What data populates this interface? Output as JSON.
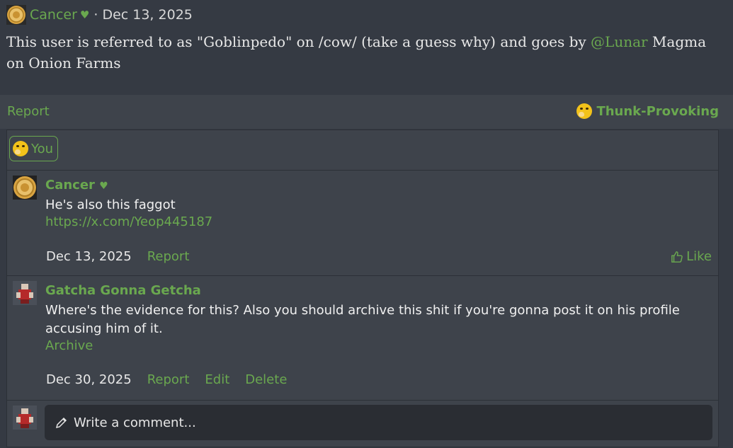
{
  "post": {
    "author": "Cancer",
    "heart": "♥",
    "separator": "·",
    "date": "Dec 13, 2025",
    "body_before": "This user is referred to as \"Goblinpedo\" on /cow/ (take a guess why) and goes by ",
    "mention": "@Lunar",
    "body_after": " Magma on Onion Farms"
  },
  "actions": {
    "report": "Report",
    "reaction_label": "Thunk-Provoking",
    "reaction_icon": "thinking-face-icon"
  },
  "reactors": {
    "you_label": "You"
  },
  "comments": [
    {
      "author": "Cancer",
      "heart": "♥",
      "text": "He's also this faggot",
      "link": "https://x.com/Yeop445187",
      "date": "Dec 13, 2025",
      "report": "Report",
      "like": "Like"
    },
    {
      "author": "Gatcha Gonna Getcha",
      "text": "Where's the evidence for this? Also you should archive this shit if you're gonna post it on his profile accusing him of it.",
      "link": "Archive",
      "date": "Dec 30, 2025",
      "report": "Report",
      "edit": "Edit",
      "delete": "Delete"
    }
  ],
  "composer": {
    "placeholder": "Write a comment..."
  },
  "colors": {
    "accent": "#6aa84f",
    "background": "#353a43",
    "panel": "#3e434b",
    "input": "#2a2d33"
  }
}
